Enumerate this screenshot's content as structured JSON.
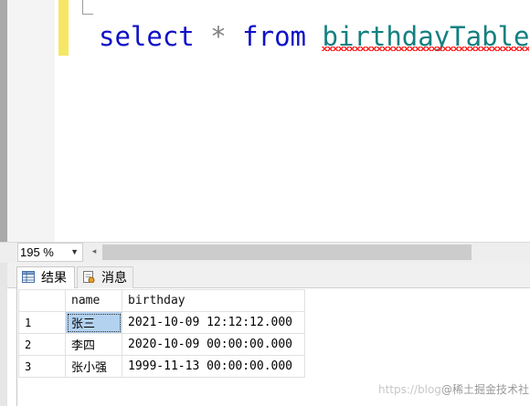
{
  "editor": {
    "tokens": {
      "kw_select": "select",
      "op_star": "*",
      "kw_from": "from",
      "table_name": "birthdayTable"
    },
    "colors": {
      "keyword": "#1010c8",
      "operator": "#808080",
      "identifier": "#138080",
      "error_squiggle": "#ff2020",
      "change_bar": "#f5e663"
    }
  },
  "status_bar": {
    "zoom": "195 %"
  },
  "result_tabs": [
    {
      "label": "结果",
      "icon": "grid-icon"
    },
    {
      "label": "消息",
      "icon": "messages-icon"
    }
  ],
  "grid": {
    "columns": [
      "name",
      "birthday"
    ],
    "rows": [
      {
        "index": "1",
        "name": "张三",
        "birthday": "2021-10-09 12:12:12.000"
      },
      {
        "index": "2",
        "name": "李四",
        "birthday": "2020-10-09 00:00:00.000"
      },
      {
        "index": "3",
        "name": "张小强",
        "birthday": "1999-11-13 00:00:00.000"
      }
    ],
    "selected_cell_color": "#b3d2f0"
  },
  "watermark": {
    "prefix": "https://blog",
    "brand": "@稀土掘金技术社区"
  }
}
